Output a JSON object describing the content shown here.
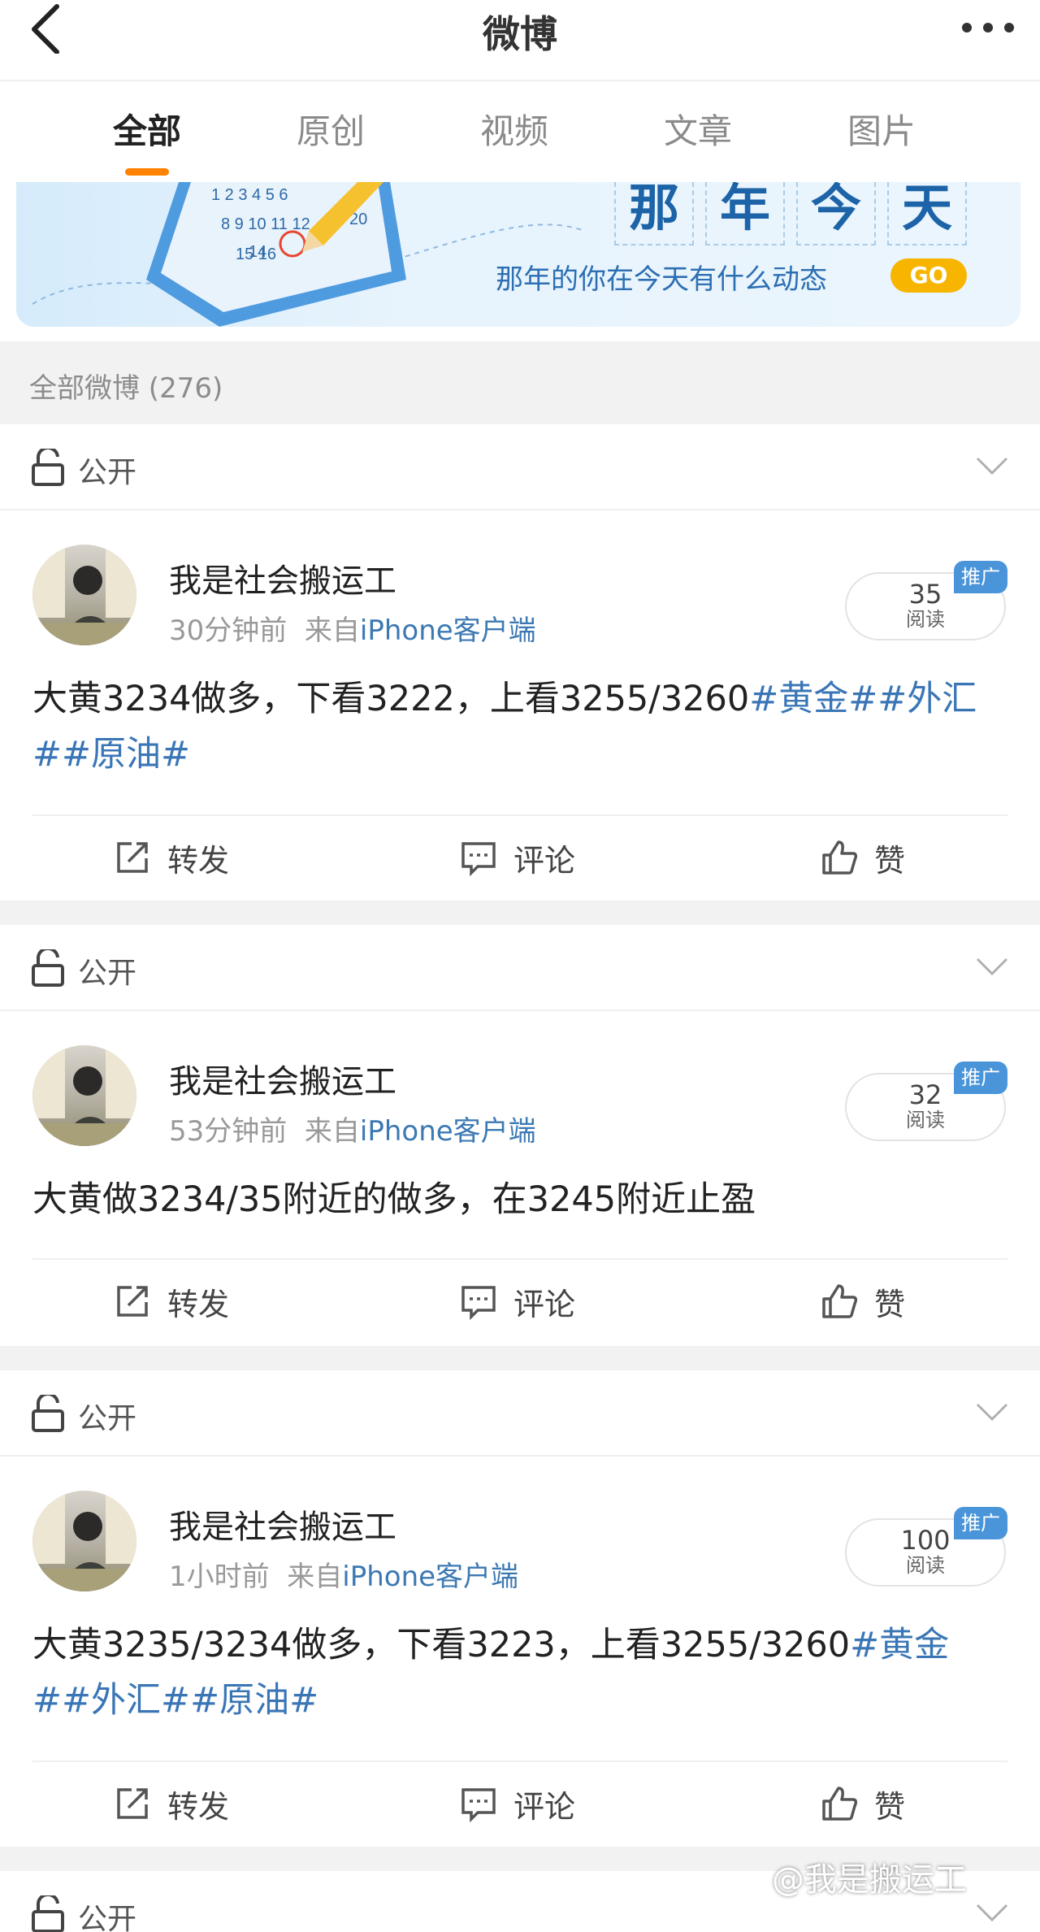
{
  "header": {
    "title": "微博"
  },
  "tabs": [
    {
      "label": "全部",
      "active": true
    },
    {
      "label": "原创",
      "active": false
    },
    {
      "label": "视频",
      "active": false
    },
    {
      "label": "文章",
      "active": false
    },
    {
      "label": "图片",
      "active": false
    }
  ],
  "banner": {
    "title_chars": [
      "那",
      "年",
      "今",
      "天"
    ],
    "subtitle": "那年的你在今天有什么动态",
    "go_label": "GO"
  },
  "count_bar": {
    "label": "全部微博 (276)"
  },
  "posts": [
    {
      "visibility": "公开",
      "author": "我是社会搬运工",
      "time": "30分钟前",
      "source_prefix": "来自",
      "source": "iPhone客户端",
      "reads": "35",
      "reads_label": "阅读",
      "promo": "推广",
      "text": "大黄3234做多，下看3222，上看3255/3260",
      "tags": "#黄金##外汇##原油#",
      "actions": {
        "repost": "转发",
        "comment": "评论",
        "like": "赞"
      }
    },
    {
      "visibility": "公开",
      "author": "我是社会搬运工",
      "time": "53分钟前",
      "source_prefix": "来自",
      "source": "iPhone客户端",
      "reads": "32",
      "reads_label": "阅读",
      "promo": "推广",
      "text": "大黄做3234/35附近的做多，在3245附近止盈",
      "tags": "",
      "actions": {
        "repost": "转发",
        "comment": "评论",
        "like": "赞"
      }
    },
    {
      "visibility": "公开",
      "author": "我是社会搬运工",
      "time": "1小时前",
      "source_prefix": "来自",
      "source": "iPhone客户端",
      "reads": "100",
      "reads_label": "阅读",
      "promo": "推广",
      "text": "大黄3235/3234做多，下看3223，上看3255/3260",
      "tags": "#黄金##外汇##原油#",
      "actions": {
        "repost": "转发",
        "comment": "评论",
        "like": "赞"
      }
    },
    {
      "visibility": "公开"
    }
  ],
  "watermark": "@我是搬运工",
  "colors": {
    "accent": "#ff8200",
    "link": "#3a76b6",
    "badge": "#4a95d9",
    "go": "#f7b500"
  }
}
